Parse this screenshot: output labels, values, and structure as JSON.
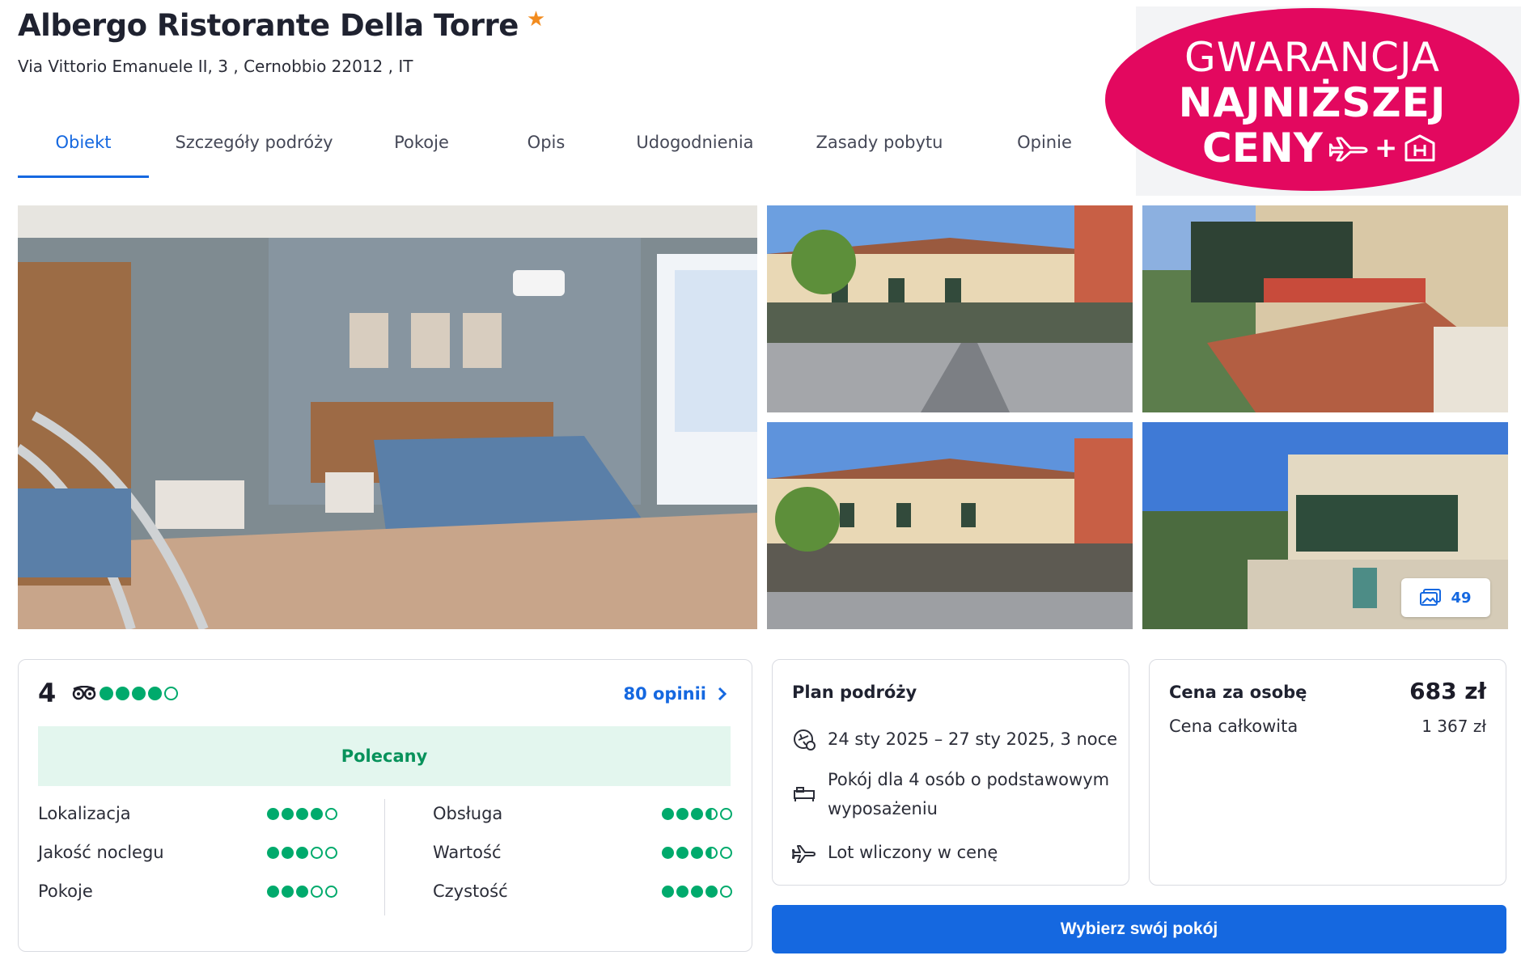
{
  "header": {
    "title": "Albergo Ristorante Della Torre",
    "address": "Via Vittorio Emanuele II, 3 , Cernobbio 22012 , IT"
  },
  "tabs": [
    {
      "label": "Obiekt",
      "active": true
    },
    {
      "label": "Szczegóły podróży"
    },
    {
      "label": "Pokoje"
    },
    {
      "label": "Opis"
    },
    {
      "label": "Udogodnienia"
    },
    {
      "label": "Zasady pobytu"
    },
    {
      "label": "Opinie"
    }
  ],
  "badge": {
    "line1": "GWARANCJA",
    "line2": "NAJNIŻSZEJ",
    "line3": "CENY",
    "icons": "+"
  },
  "gallery": {
    "photo_count": "49"
  },
  "reviews": {
    "score": "4",
    "score_dots": 4,
    "link": "80 opinii",
    "verdict": "Polecany",
    "criteria": [
      {
        "label": "Lokalizacja",
        "rating": 4
      },
      {
        "label": "Jakość noclegu",
        "rating": 3
      },
      {
        "label": "Pokoje",
        "rating": 3
      },
      {
        "label": "Obsługa",
        "rating": 3.5
      },
      {
        "label": "Wartość",
        "rating": 3.5
      },
      {
        "label": "Czystość",
        "rating": 4
      }
    ]
  },
  "plan": {
    "title": "Plan podróży",
    "dates": "24 sty 2025 – 27 sty 2025, 3 noce",
    "room": "Pokój dla 4 osób o podstawowym wyposażeniu",
    "flight": "Lot wliczony w cenę"
  },
  "price": {
    "per_person_label": "Cena za osobę",
    "per_person": "683 zł",
    "total_label": "Cena całkowita",
    "total": "1 367 zł"
  },
  "cta": {
    "label": "Wybierz swój pokój"
  },
  "colors": {
    "accent": "#1568e0",
    "badge": "#e3085f",
    "rating_green": "#00aa6c"
  }
}
